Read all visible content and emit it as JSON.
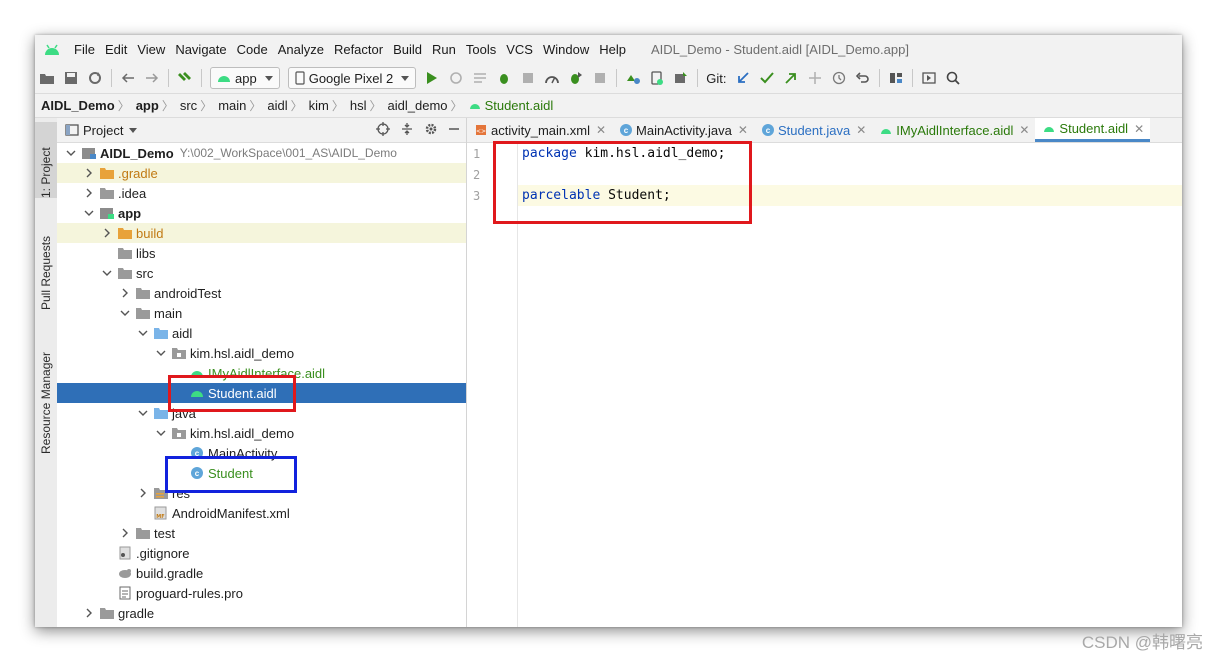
{
  "menubar": {
    "items": [
      "File",
      "Edit",
      "View",
      "Navigate",
      "Code",
      "Analyze",
      "Refactor",
      "Build",
      "Run",
      "Tools",
      "VCS",
      "Window",
      "Help"
    ],
    "window_title": "AIDL_Demo - Student.aidl [AIDL_Demo.app]"
  },
  "toolbar": {
    "run_config": "app",
    "device": "Google Pixel 2",
    "git_label": "Git:"
  },
  "breadcrumb": [
    "AIDL_Demo",
    "app",
    "src",
    "main",
    "aidl",
    "kim",
    "hsl",
    "aidl_demo",
    "Student.aidl"
  ],
  "left_strip": {
    "project_tab": "1: Project",
    "pull_requests_tab": "Pull Requests",
    "resource_manager_tab": "Resource Manager"
  },
  "project_panel": {
    "title": "Project",
    "tree": [
      {
        "label": "AIDL_Demo",
        "path": "Y:\\002_WorkSpace\\001_AS\\AIDL_Demo",
        "depth": 0,
        "expanded": true
      },
      {
        "label": ".gradle",
        "depth": 1,
        "expanded": false
      },
      {
        "label": ".idea",
        "depth": 1,
        "expanded": false
      },
      {
        "label": "app",
        "depth": 1,
        "expanded": true
      },
      {
        "label": "build",
        "depth": 2,
        "expanded": false
      },
      {
        "label": "libs",
        "depth": 2
      },
      {
        "label": "src",
        "depth": 2,
        "expanded": true
      },
      {
        "label": "androidTest",
        "depth": 3,
        "expanded": false
      },
      {
        "label": "main",
        "depth": 3,
        "expanded": true
      },
      {
        "label": "aidl",
        "depth": 4,
        "expanded": true
      },
      {
        "label": "kim.hsl.aidl_demo",
        "depth": 5,
        "expanded": true
      },
      {
        "label": "IMyAidlInterface.aidl",
        "depth": 6
      },
      {
        "label": "Student.aidl",
        "depth": 6
      },
      {
        "label": "java",
        "depth": 4,
        "expanded": true
      },
      {
        "label": "kim.hsl.aidl_demo",
        "depth": 5,
        "expanded": true
      },
      {
        "label": "MainActivity",
        "depth": 6
      },
      {
        "label": "Student",
        "depth": 6
      },
      {
        "label": "res",
        "depth": 4,
        "expanded": false
      },
      {
        "label": "AndroidManifest.xml",
        "depth": 4
      },
      {
        "label": "test",
        "depth": 3,
        "expanded": false
      },
      {
        "label": ".gitignore",
        "depth": 2
      },
      {
        "label": "build.gradle",
        "depth": 2
      },
      {
        "label": "proguard-rules.pro",
        "depth": 2
      },
      {
        "label": "gradle",
        "depth": 1,
        "expanded": false
      }
    ]
  },
  "editor": {
    "tabs": [
      "activity_main.xml",
      "MainActivity.java",
      "Student.java",
      "IMyAidlInterface.aidl",
      "Student.aidl"
    ],
    "active_tab": "Student.aidl",
    "line_numbers": [
      "1",
      "2",
      "3"
    ],
    "code": {
      "line1_kw": "package",
      "line1_rest": " kim.hsl.aidl_demo;",
      "line3_kw": "parcelable",
      "line3_rest": " Student;"
    }
  },
  "watermark": "CSDN @韩曙亮",
  "colors": {
    "selection": "#2f6fb7",
    "annotation_red": "#e0181c",
    "annotation_blue": "#1122dd",
    "keyword": "#0033b3"
  }
}
